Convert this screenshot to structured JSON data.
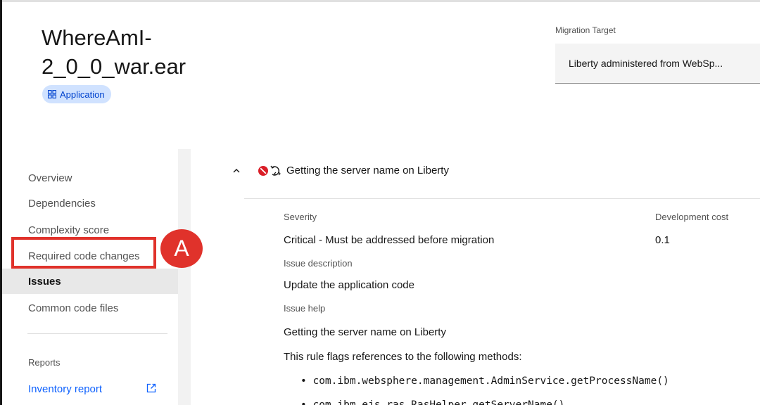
{
  "app": {
    "title_line1": "WhereAmI-",
    "title_line2": "2_0_0_war.ear",
    "tag_label": "Application",
    "tag_icon": "application-icon"
  },
  "migration_target": {
    "label": "Migration Target",
    "value": "Liberty administered from WebSp..."
  },
  "sidebar": {
    "items": [
      {
        "label": "Overview",
        "active": false
      },
      {
        "label": "Dependencies",
        "active": false
      },
      {
        "label": "Complexity score",
        "active": false
      },
      {
        "label": "Required code changes",
        "active": false
      },
      {
        "label": "Issues",
        "active": true
      },
      {
        "label": "Common code files",
        "active": false
      }
    ],
    "reports_label": "Reports",
    "inventory_link": "Inventory report",
    "inventory_icon": "external-link-icon"
  },
  "issue": {
    "title": "Getting the server name on Liberty",
    "status_icon": "critical-icon",
    "rule_icon": "code-rule-icon",
    "severity_label": "Severity",
    "severity_value": "Critical - Must be addressed before migration",
    "dev_cost_label": "Development cost",
    "dev_cost_value": "0.1",
    "description_label": "Issue description",
    "description_value": "Update the application code",
    "help_label": "Issue help",
    "help_title": "Getting the server name on Liberty",
    "help_text": "This rule flags references to the following methods:",
    "methods": [
      "• com.ibm.websphere.management.AdminService.getProcessName()",
      "• com.ibm.ejs.ras.RasHelper.getServerName()"
    ]
  },
  "annotation": {
    "badge": "A",
    "color": "#e0322b"
  },
  "colors": {
    "accent": "#0f62fe",
    "tag_bg": "#d0e2ff",
    "tag_fg": "#0043ce",
    "critical": "#da1e28"
  }
}
